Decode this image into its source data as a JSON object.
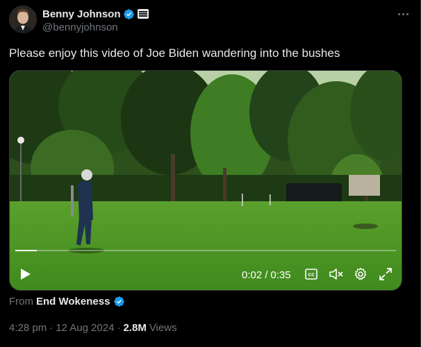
{
  "author": {
    "display_name": "Benny Johnson",
    "handle": "@bennyjohnson",
    "avatar_icon": "profile-photo",
    "verified_icon": "verified-badge-icon",
    "affiliate_icon": "affiliate-badge-icon"
  },
  "tweet": {
    "text": "Please enjoy this video of Joe Biden wandering into the bushes"
  },
  "video": {
    "current_time": "0:02",
    "separator": "/",
    "duration": "0:35",
    "progress": 0.057,
    "muted": true
  },
  "source": {
    "prefix": "From",
    "name": "End Wokeness"
  },
  "meta": {
    "time": "4:28 pm",
    "date": "12 Aug 2024",
    "views_count": "2.8M",
    "views_label": "Views",
    "sep": "·"
  },
  "colors": {
    "verified": "#1d9bf0",
    "text_primary": "#e7e9ea",
    "text_secondary": "#71767b",
    "background": "#000000"
  }
}
